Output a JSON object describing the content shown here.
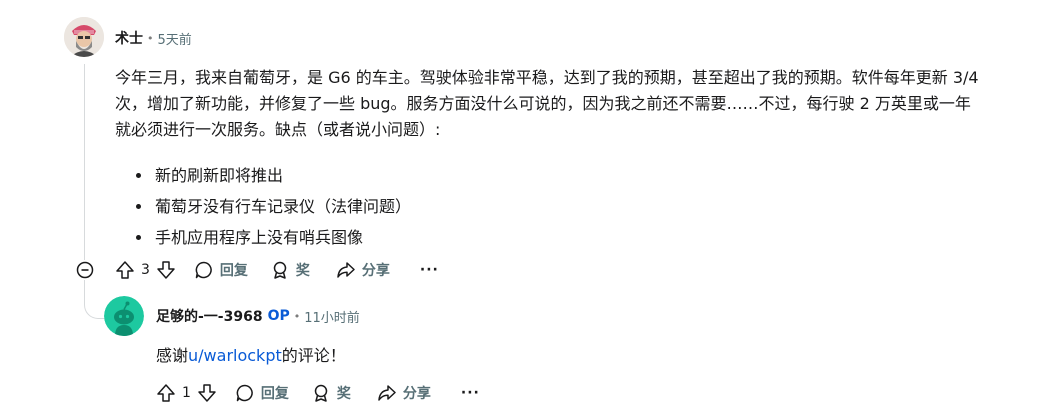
{
  "comment": {
    "username": "术士",
    "time": "5天前",
    "paragraph": "今年三月，我来自葡萄牙，是 G6 的车主。驾驶体验非常平稳，达到了我的预期，甚至超出了我的预期。软件每年更新 3/4 次，增加了新功能，并修复了一些 bug。服务方面没什么可说的，因为我之前还不需要……不过，每行驶 2 万英里或一年就必须进行一次服务。缺点（或者说小问题）:",
    "bullets": [
      "新的刷新即将推出",
      "葡萄牙没有行车记录仪（法律问题）",
      "手机应用程序上没有哨兵图像"
    ],
    "votes": "3",
    "reply_label": "回复",
    "award_label": "奖",
    "share_label": "分享",
    "more_label": "···"
  },
  "reply": {
    "username": "足够的-一-3968",
    "op_badge": "OP",
    "time": "11小时前",
    "text_prefix": "感谢",
    "mention": "u/warlockpt",
    "text_suffix": "的评论！",
    "votes": "1",
    "reply_label": "回复",
    "award_label": "奖",
    "share_label": "分享",
    "more_label": "···"
  },
  "colors": {
    "text": "#1a1a1b",
    "meta": "#576f76",
    "link": "#0a5bd6",
    "reply_avatar": "#1dc9a0"
  },
  "icons": [
    "collapse-icon",
    "upvote-icon",
    "downvote-icon",
    "comment-bubble-icon",
    "award-icon",
    "share-arrow-icon",
    "more-icon"
  ]
}
